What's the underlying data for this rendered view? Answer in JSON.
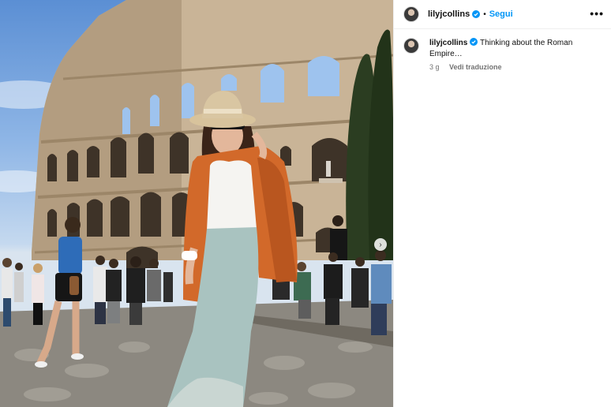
{
  "post": {
    "username": "lilyjcollins",
    "follow_label": "Segui",
    "separator": "•",
    "more_label": "•••",
    "caption": "Thinking about the Roman Empire…",
    "time": "3 g",
    "translate_label": "Vedi traduzione",
    "next_arrow": "›"
  },
  "colors": {
    "accent": "#0095f6",
    "verified": "#0095f6"
  },
  "icons": [
    "verified-icon",
    "more-options-icon",
    "next-arrow-icon"
  ]
}
